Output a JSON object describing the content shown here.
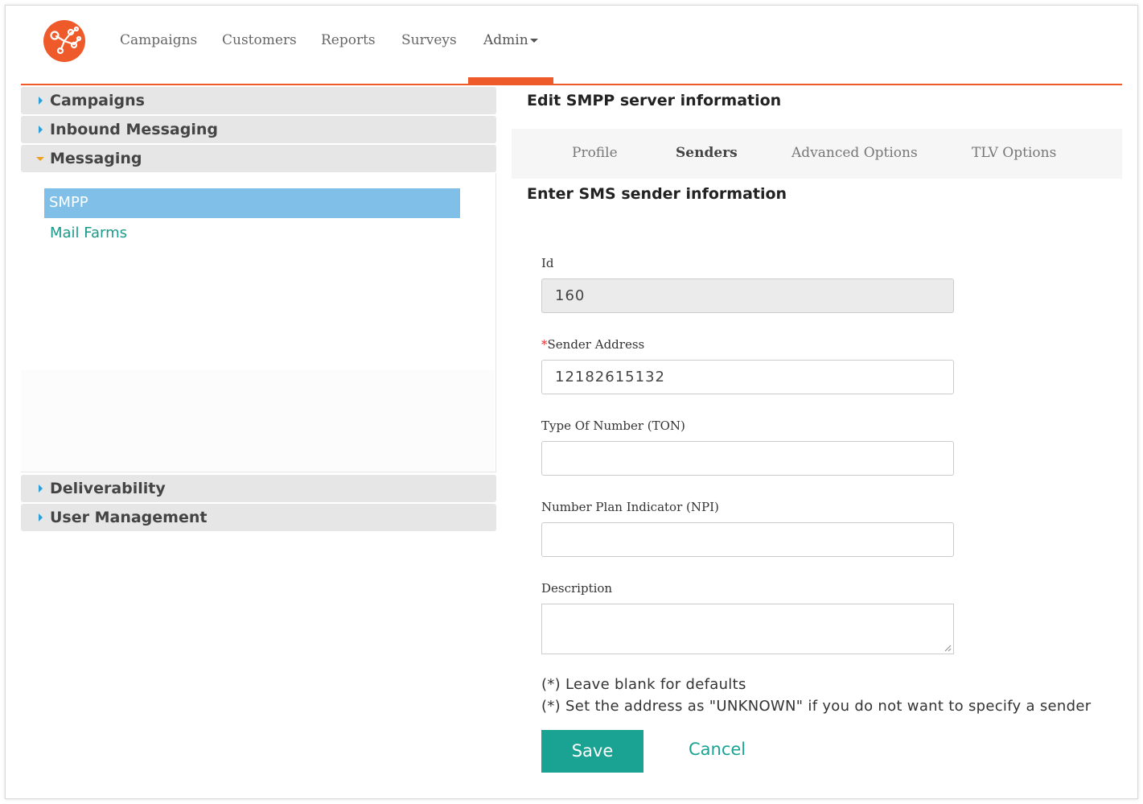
{
  "nav": {
    "items": [
      "Campaigns",
      "Customers",
      "Reports",
      "Surveys"
    ],
    "admin_label": "Admin",
    "active": "Admin"
  },
  "sidebar": {
    "sections": [
      {
        "label": "Campaigns",
        "expanded": false
      },
      {
        "label": "Inbound Messaging",
        "expanded": false
      },
      {
        "label": "Messaging",
        "expanded": true,
        "children": [
          {
            "label": "SMPP",
            "selected": true
          },
          {
            "label": "Mail Farms",
            "selected": false
          }
        ]
      },
      {
        "label": "Deliverability",
        "expanded": false
      },
      {
        "label": "User Management",
        "expanded": false
      }
    ]
  },
  "main": {
    "title": "Edit SMPP server information",
    "tabs": [
      {
        "label": "Profile",
        "active": false
      },
      {
        "label": "Senders",
        "active": true
      },
      {
        "label": "Advanced Options",
        "active": false
      },
      {
        "label": "TLV Options",
        "active": false
      }
    ],
    "subtitle": "Enter SMS sender information",
    "form": {
      "id_label": "Id",
      "id_value": "160",
      "sender_required_mark": "*",
      "sender_label": "Sender Address",
      "sender_value": "12182615132",
      "ton_label": "Type Of Number (TON)",
      "ton_value": "",
      "npi_label": "Number Plan Indicator (NPI)",
      "npi_value": "",
      "description_label": "Description",
      "description_value": ""
    },
    "notes": [
      "(*) Leave blank for defaults",
      "(*) Set the address as \"UNKNOWN\" if you do not want to specify a sender"
    ],
    "save_label": "Save",
    "cancel_label": "Cancel"
  },
  "colors": {
    "brand": "#ef5a2a",
    "accent": "#1aa393",
    "selected": "#80c0e8"
  }
}
